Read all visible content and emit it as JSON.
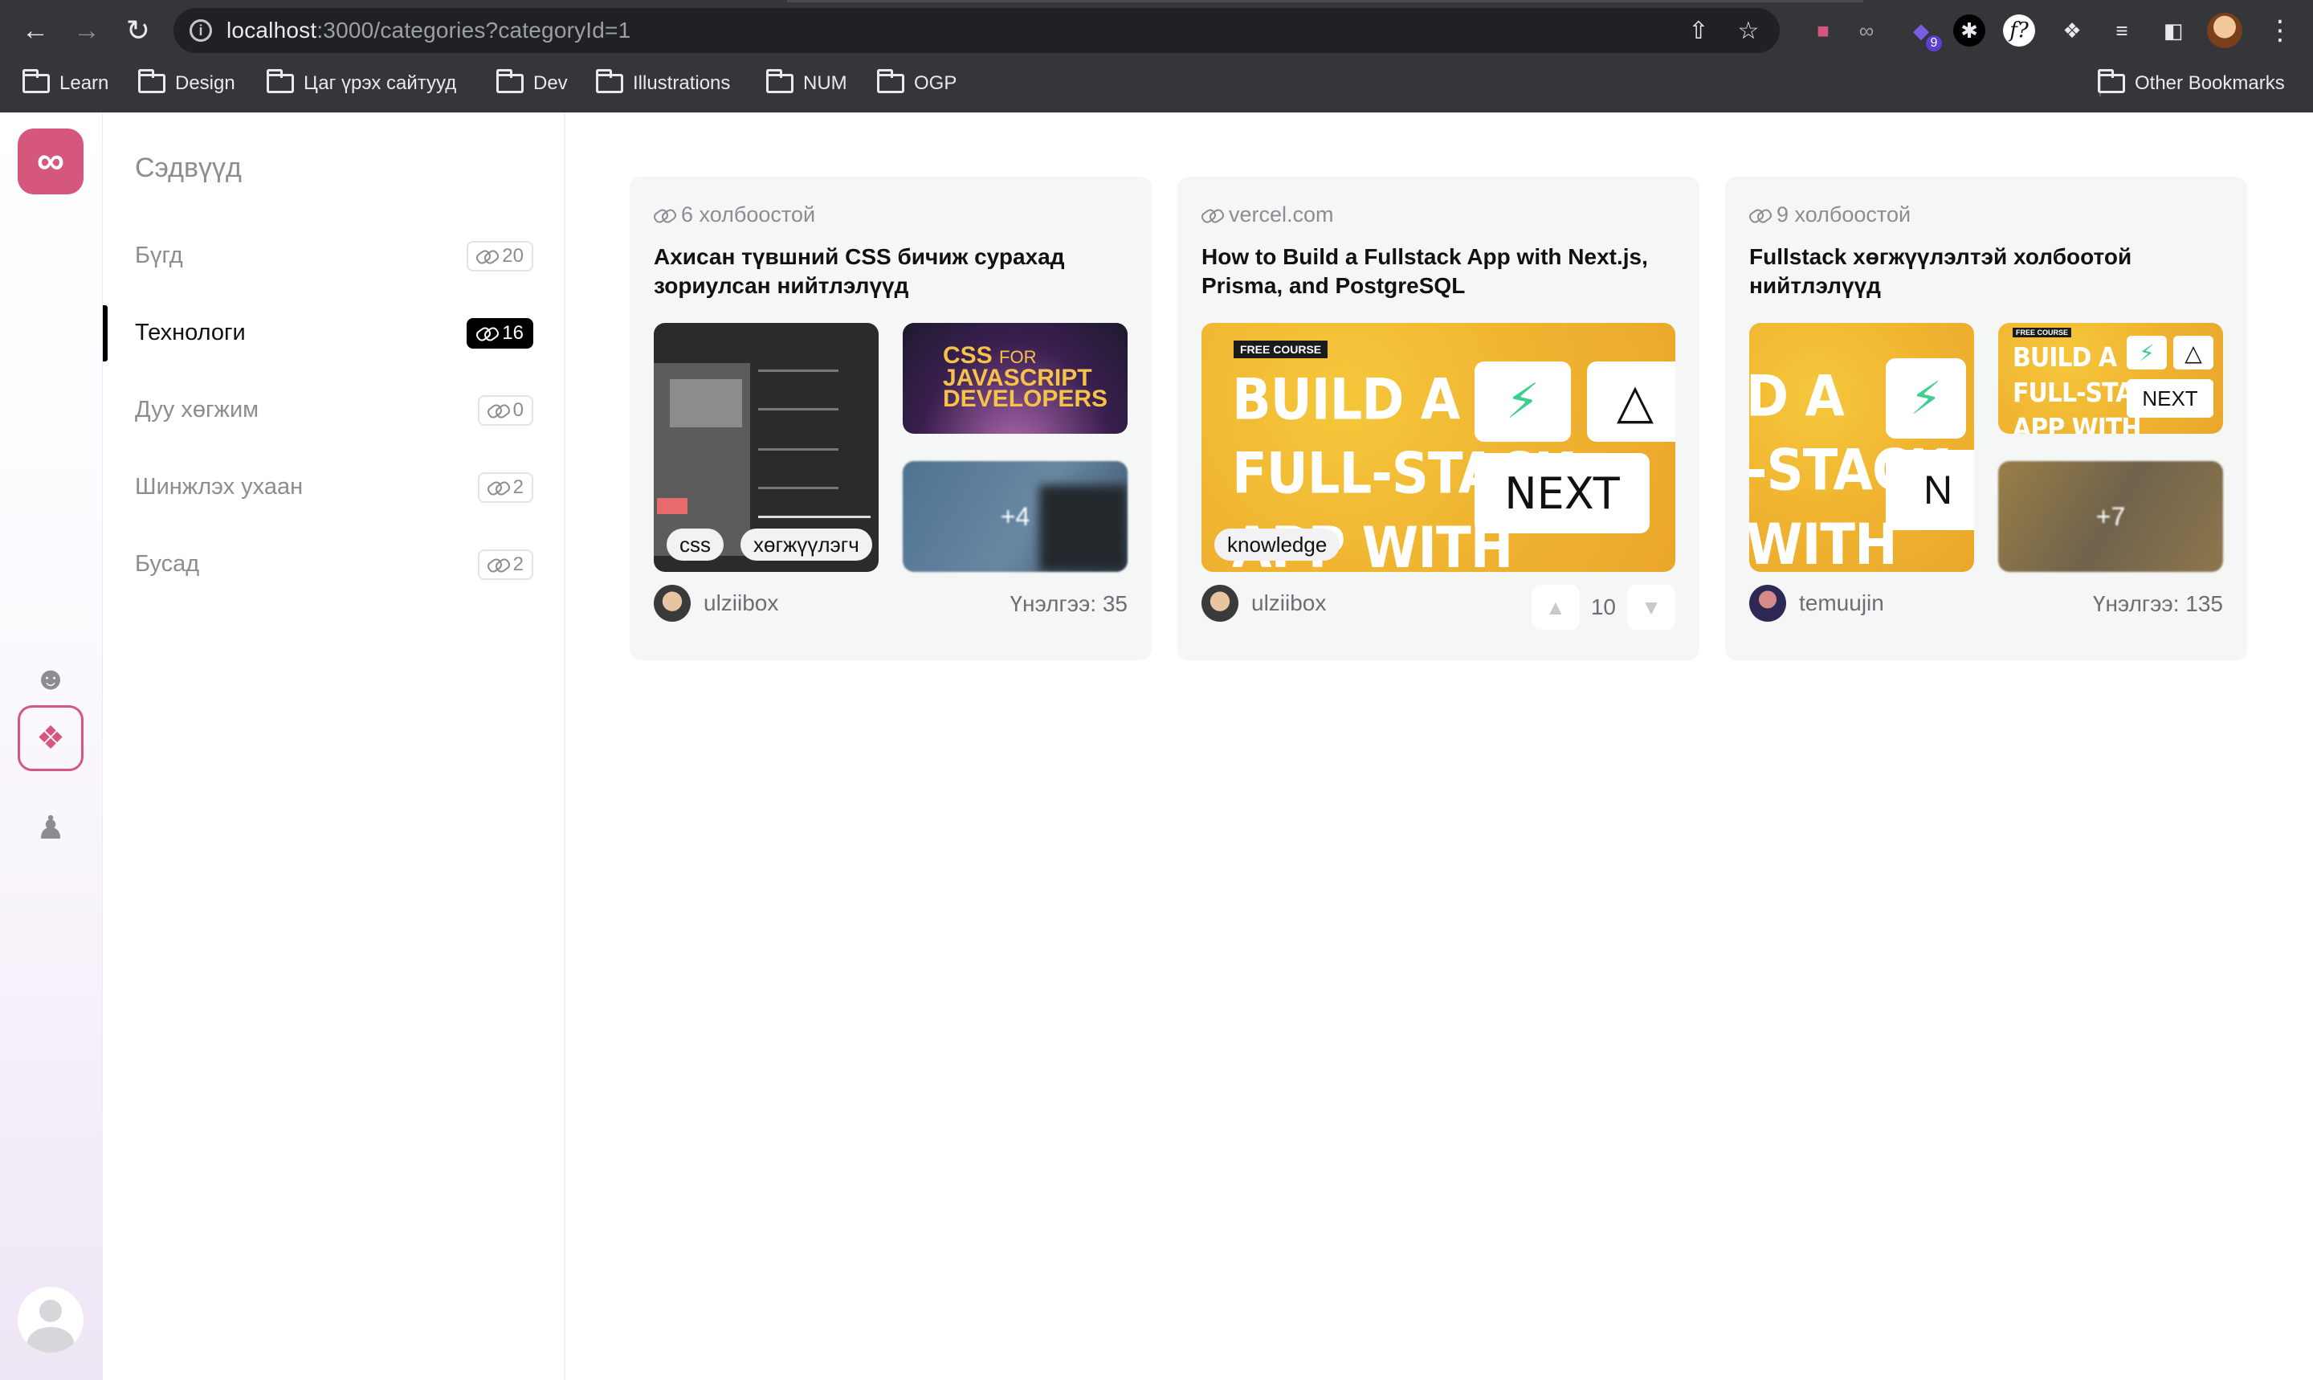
{
  "browser": {
    "url_host": "localhost",
    "url_rest": ":3000/categories?categoryId=1",
    "extension_badge": "9",
    "bookmarks": [
      "Learn",
      "Design",
      "Цаг үрэх сайтууд",
      "Dev",
      "Illustrations",
      "NUM",
      "OGP"
    ],
    "other_bookmarks": "Other Bookmarks"
  },
  "sidebar": {
    "title": "Сэдвүүд",
    "categories": [
      {
        "label": "Бүгд",
        "count": "20"
      },
      {
        "label": "Технологи",
        "count": "16"
      },
      {
        "label": "Дуу хөгжим",
        "count": "0"
      },
      {
        "label": "Шинжлэх ухаан",
        "count": "2"
      },
      {
        "label": "Бусад",
        "count": "2"
      }
    ]
  },
  "cards": [
    {
      "meta": "6 холбоостой",
      "title": "Ахисан түвшний CSS бичиж сурахад зориулсан нийтлэлүүд",
      "tags": [
        "css",
        "хөгжүүлэгч"
      ],
      "more": "+4",
      "author": "ulziibox",
      "score": "Үнэлгээ: 35",
      "thumb_text": {
        "css_for": "CSS",
        "for_word": "FOR",
        "js": "JAVASCRIPT",
        "dev": "DEVELOPERS"
      }
    },
    {
      "meta": "vercel.com",
      "title": "How to Build a Fullstack App with Next.js, Prisma, and PostgreSQL",
      "tags": [
        "knowledge"
      ],
      "author": "ulziibox",
      "votes": "10",
      "thumb_text": {
        "free": "FREE COURSE",
        "line1": "BUILD A",
        "line2": "FULL-STACK",
        "line3": "APP WITH",
        "next": "NEXT"
      }
    },
    {
      "meta": "9 холбоостой",
      "title": "Fullstack хөгжүүлэлтэй холбоотой нийтлэлүүд",
      "more": "+7",
      "author": "temuujin",
      "score": "Үнэлгээ: 135",
      "thumb_text": {
        "line1": "D A",
        "line2": "-STACK",
        "line3": "WITH",
        "mini1": "BUILD A",
        "mini2": "FULL-STACK",
        "mini3": "APP WITH",
        "free": "FREE COURSE"
      }
    }
  ],
  "colors": {
    "accent": "#d6577e",
    "chrome": "#35363a",
    "card_bg": "#f5f6f6"
  }
}
